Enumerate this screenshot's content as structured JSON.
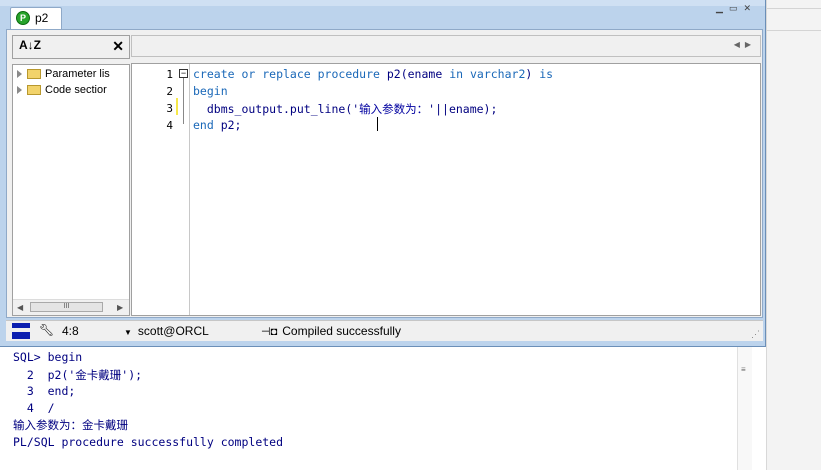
{
  "window": {
    "tab_label": "p2",
    "tab_icon": "P"
  },
  "object_browser": {
    "sort_label": "A↓Z",
    "items": [
      {
        "label": "Parameter lis"
      },
      {
        "label": "Code sectior"
      }
    ],
    "scroll_grip": "III"
  },
  "editor": {
    "line_numbers": [
      "1",
      "2",
      "3",
      "4"
    ],
    "lines": [
      {
        "kw1": "create or replace procedure",
        "txt1": " p2(ename ",
        "kw2": "in",
        "txt2": " ",
        "kw3": "varchar2",
        "txt3": ") ",
        "kw4": "is"
      },
      {
        "kw1": "begin"
      },
      {
        "txt1": "  dbms_output.put_line('",
        "ch": "输入参数为：",
        "txt2": "'||ename);"
      },
      {
        "kw1": "end",
        "txt1": " p2;"
      }
    ]
  },
  "statusbar": {
    "position": "4:8",
    "connection": "scott@ORCL",
    "message": "Compiled successfully"
  },
  "output": {
    "lines": [
      "SQL> begin",
      "  2  p2('金卡戴珊');",
      "  3  end;",
      "  4  /",
      "输入参数为：金卡戴珊",
      "PL/SQL procedure successfully completed"
    ]
  },
  "colors": {
    "keyword": "#1a68b8",
    "code_text": "#000080",
    "window_frame": "#bcd3ec"
  }
}
